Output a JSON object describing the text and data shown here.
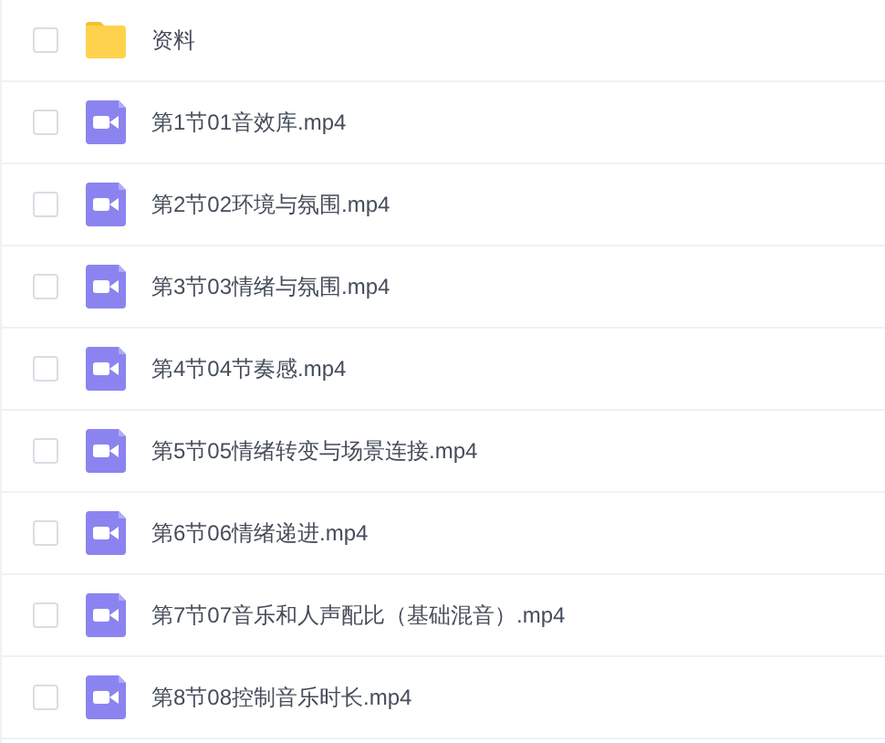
{
  "files": [
    {
      "kind": "folder",
      "name": "资料",
      "checked": false
    },
    {
      "kind": "video",
      "name": "第1节01音效库.mp4",
      "checked": false
    },
    {
      "kind": "video",
      "name": "第2节02环境与氛围.mp4",
      "checked": false
    },
    {
      "kind": "video",
      "name": "第3节03情绪与氛围.mp4",
      "checked": false
    },
    {
      "kind": "video",
      "name": "第4节04节奏感.mp4",
      "checked": false
    },
    {
      "kind": "video",
      "name": "第5节05情绪转变与场景连接.mp4",
      "checked": false
    },
    {
      "kind": "video",
      "name": "第6节06情绪递进.mp4",
      "checked": false
    },
    {
      "kind": "video",
      "name": "第7节07音乐和人声配比（基础混音）.mp4",
      "checked": false
    },
    {
      "kind": "video",
      "name": "第8节08控制音乐时长.mp4",
      "checked": false
    }
  ]
}
